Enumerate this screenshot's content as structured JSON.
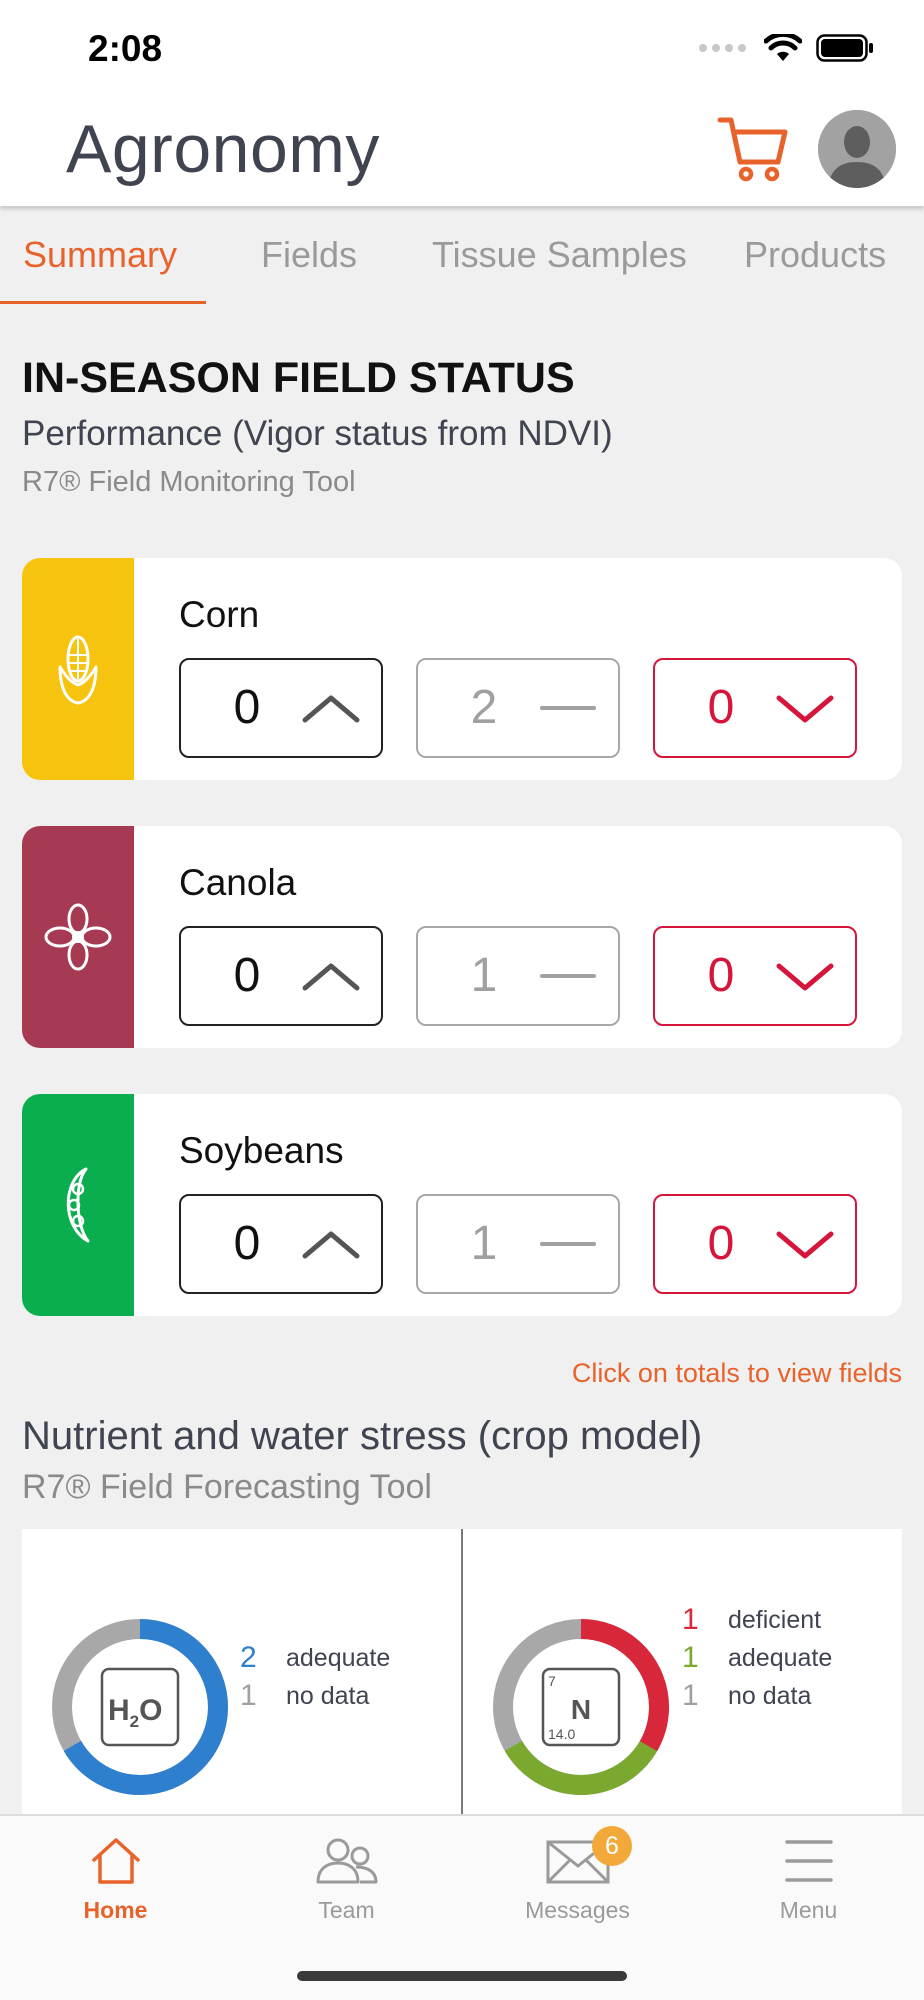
{
  "status_bar": {
    "time": "2:08"
  },
  "header": {
    "title": "Agronomy"
  },
  "tabs": [
    {
      "label": "Summary",
      "active": true
    },
    {
      "label": "Fields",
      "active": false
    },
    {
      "label": "Tissue Samples",
      "active": false
    },
    {
      "label": "Products",
      "active": false
    }
  ],
  "in_season": {
    "title": "IN-SEASON FIELD STATUS",
    "subtitle": "Performance (Vigor status from NDVI)",
    "tool": "R7® Field Monitoring Tool"
  },
  "crops": [
    {
      "name": "Corn",
      "color": "#f6c40f",
      "icon": "corn-icon",
      "up": "0",
      "flat": "2",
      "down": "0"
    },
    {
      "name": "Canola",
      "color": "#a63a52",
      "icon": "canola-icon",
      "up": "0",
      "flat": "1",
      "down": "0"
    },
    {
      "name": "Soybeans",
      "color": "#0aae4f",
      "icon": "soybean-icon",
      "up": "0",
      "flat": "1",
      "down": "0"
    }
  ],
  "hint": "Click on totals to view fields",
  "stress": {
    "title": "Nutrient and water stress (crop model)",
    "tool": "R7® Field Forecasting Tool",
    "water": {
      "icon_label_main": "H",
      "icon_label_sub": "2",
      "icon_label_end": "O",
      "rows": [
        {
          "count": "2",
          "label": "adequate",
          "color": "#2f7fcf"
        },
        {
          "count": "1",
          "label": "no data",
          "color": "#a0a0a0"
        }
      ]
    },
    "nitrogen": {
      "symbol": "N",
      "atomic_number": "7",
      "atomic_mass": "14.0",
      "rows": [
        {
          "count": "1",
          "label": "deficient",
          "color": "#d8263a"
        },
        {
          "count": "1",
          "label": "adequate",
          "color": "#7ba82e"
        },
        {
          "count": "1",
          "label": "no data",
          "color": "#a0a0a0"
        }
      ]
    }
  },
  "nav": [
    {
      "label": "Home",
      "active": true
    },
    {
      "label": "Team",
      "active": false
    },
    {
      "label": "Messages",
      "active": false,
      "badge": "6"
    },
    {
      "label": "Menu",
      "active": false
    }
  ],
  "colors": {
    "accent": "#e8632b",
    "down": "#d5153a"
  }
}
